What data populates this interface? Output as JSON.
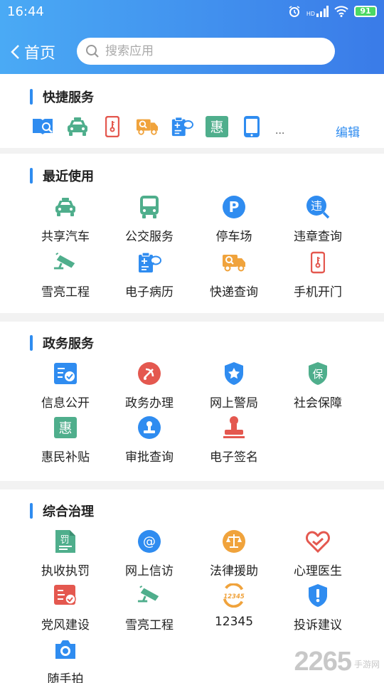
{
  "status_bar": {
    "time": "16:44",
    "network": "HD",
    "battery": "91"
  },
  "nav": {
    "back_label": "首页"
  },
  "search": {
    "placeholder": "搜索应用"
  },
  "quick": {
    "title": "快捷服务",
    "icons": [
      "reader-icon",
      "taxi-icon",
      "phone-door-icon",
      "express-truck-icon",
      "medical-record-icon",
      "hui-icon",
      "tablet-icon"
    ],
    "more": "...",
    "edit_label": "编辑"
  },
  "recent": {
    "title": "最近使用",
    "items": [
      {
        "label": "共享汽车",
        "icon": "car-icon"
      },
      {
        "label": "公交服务",
        "icon": "bus-icon"
      },
      {
        "label": "停车场",
        "icon": "parking-icon"
      },
      {
        "label": "违章查询",
        "icon": "violation-icon"
      },
      {
        "label": "雪亮工程",
        "icon": "cctv-icon"
      },
      {
        "label": "电子病历",
        "icon": "medical-record-icon"
      },
      {
        "label": "快递查询",
        "icon": "express-truck-icon"
      },
      {
        "label": "手机开门",
        "icon": "phone-door-icon"
      }
    ]
  },
  "gov": {
    "title": "政务服务",
    "items": [
      {
        "label": "信息公开",
        "icon": "info-card-icon"
      },
      {
        "label": "政务办理",
        "icon": "party-emblem-icon"
      },
      {
        "label": "网上警局",
        "icon": "police-badge-icon"
      },
      {
        "label": "社会保障",
        "icon": "shield-bao-icon"
      },
      {
        "label": "惠民补贴",
        "icon": "hui-icon"
      },
      {
        "label": "审批查询",
        "icon": "stamp-circle-icon"
      },
      {
        "label": "电子签名",
        "icon": "seal-icon"
      }
    ],
    "glyphs": {
      "bao": "保",
      "hui": "惠",
      "wei": "违"
    }
  },
  "governance": {
    "title": "综合治理",
    "items": [
      {
        "label": "执收执罚",
        "icon": "penalty-doc-icon"
      },
      {
        "label": "网上信访",
        "icon": "at-icon"
      },
      {
        "label": "法律援助",
        "icon": "scales-icon"
      },
      {
        "label": "心理医生",
        "icon": "heart-hands-icon"
      },
      {
        "label": "党风建设",
        "icon": "party-card-icon"
      },
      {
        "label": "雪亮工程",
        "icon": "cctv-icon"
      },
      {
        "label": "12345",
        "icon": "hotline-12345-icon"
      },
      {
        "label": "投诉建议",
        "icon": "complaint-shield-icon"
      },
      {
        "label": "随手拍",
        "icon": "camera-icon"
      }
    ],
    "glyphs": {
      "fa": "罚",
      "hotline": "12345"
    }
  },
  "watermark": {
    "number": "2265",
    "text": "手游网"
  },
  "colors": {
    "header_start": "#4aaaf5",
    "header_end": "#3a7be8",
    "accent": "#2f8cf0",
    "green": "#4fae8c",
    "orange": "#f0a33c",
    "red": "#e4584f"
  }
}
